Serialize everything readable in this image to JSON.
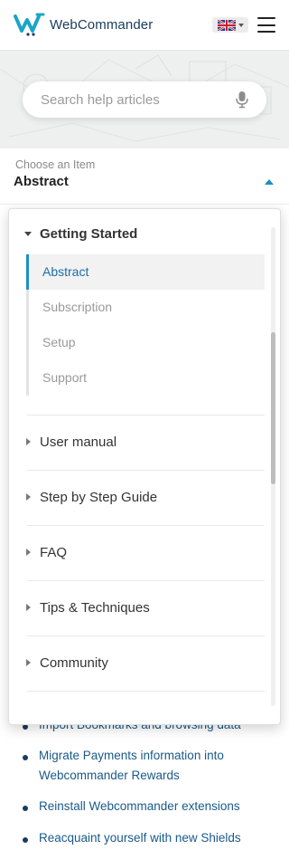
{
  "header": {
    "brand": "WebCommander",
    "language_icon": "uk-flag-icon",
    "menu_icon": "hamburger-icon"
  },
  "search": {
    "placeholder": "Search help articles",
    "icon": "microphone-icon"
  },
  "chooser": {
    "caption": "Choose an Item",
    "value": "Abstract",
    "icon": "caret-up-icon"
  },
  "dropdown": {
    "expanded_group": {
      "label": "Getting Started",
      "items": [
        {
          "label": "Abstract",
          "active": true
        },
        {
          "label": "Subscription",
          "active": false
        },
        {
          "label": "Setup",
          "active": false
        },
        {
          "label": "Support",
          "active": false
        }
      ]
    },
    "categories": [
      {
        "label": "User manual"
      },
      {
        "label": "Step by Step Guide"
      },
      {
        "label": "FAQ"
      },
      {
        "label": "Tips & Techniques"
      },
      {
        "label": "Community"
      }
    ]
  },
  "articles": [
    {
      "text": "Import Bookmarks and browsing data"
    },
    {
      "text": "Migrate Payments information into Webcommander Rewards"
    },
    {
      "text": "Reinstall Webcommander extensions"
    },
    {
      "text": "Reacquaint yourself with new Shields"
    }
  ],
  "colors": {
    "accent": "#1a8fc9",
    "brand_text": "#1a3b5d",
    "link": "#1a5a8a"
  }
}
